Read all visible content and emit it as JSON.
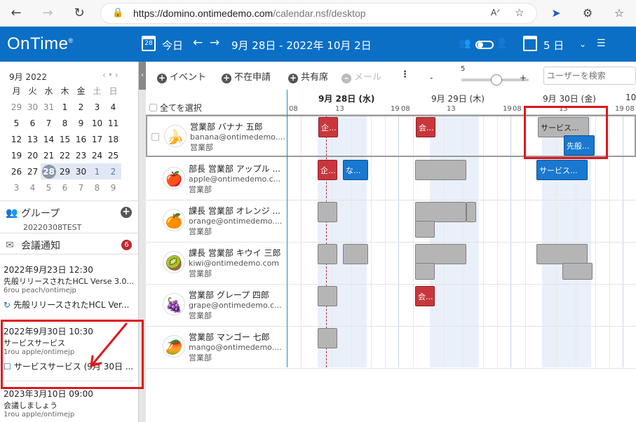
{
  "browser": {
    "url_host": "https://domino.ontimedemo.com",
    "url_path": "/calendar.nsf/desktop"
  },
  "header": {
    "logo": "OnTime",
    "cal_day": "28",
    "today": "今日",
    "date_range": "9月 28日 - 2022年 10月 2日",
    "view_days": "5 日"
  },
  "mini_calendar": {
    "title": "9月 2022",
    "weekdays": [
      "月",
      "火",
      "水",
      "木",
      "金",
      "土",
      "日"
    ],
    "weeks": [
      [
        "29",
        "30",
        "31",
        "1",
        "2",
        "3",
        "4"
      ],
      [
        "5",
        "6",
        "7",
        "8",
        "9",
        "10",
        "11"
      ],
      [
        "12",
        "13",
        "14",
        "15",
        "16",
        "17",
        "18"
      ],
      [
        "19",
        "20",
        "21",
        "22",
        "23",
        "24",
        "25"
      ],
      [
        "26",
        "27",
        "28",
        "29",
        "30",
        "1",
        "2"
      ],
      [
        "3",
        "4",
        "5",
        "6",
        "7",
        "8",
        "9"
      ]
    ]
  },
  "groups": {
    "title": "グループ",
    "name": "20220308TEST"
  },
  "notifications": {
    "title": "会議通知",
    "count": "6",
    "items": [
      {
        "date": "2022年9月23日  12:30",
        "subject": "先般リリースされたHCL Verse 3.0...",
        "who": "6rou peach/ontimejp",
        "link": "先般リリースされたHCL Ver..."
      },
      {
        "date": "2022年9月30日  10:30",
        "subject": "サービスサービス",
        "who": "1rou apple/ontimejp",
        "link": "サービスサービス (9月 30日 ..."
      },
      {
        "date": "2023年3月10日  09:00",
        "subject": "会議しましょう",
        "who": "1rou apple/ontimejp",
        "link": ""
      }
    ]
  },
  "toolbar": {
    "event": "イベント",
    "absence": "不在申請",
    "shared_seat": "共有席",
    "mail": "メール",
    "zoom_value": "5",
    "minus": "-",
    "plus": "+",
    "search_placeholder": "ユーザーを検索"
  },
  "timeline": {
    "select_all": "全てを選択",
    "days": [
      {
        "label": "9月 28日 (水)"
      },
      {
        "label": "9月 29日 (木)"
      },
      {
        "label": "9月 30日 (金)"
      },
      {
        "label": "10"
      }
    ],
    "hours": [
      "08",
      "13",
      "19",
      "08",
      "13",
      "19",
      "08",
      "13",
      "19",
      "08"
    ]
  },
  "people": [
    {
      "name": "営業部 バナナ 五郎",
      "email": "banana@ontimedemo....",
      "dept": "営業部",
      "avatar": "banana-icon"
    },
    {
      "name": "部長 営業部 アップル ...",
      "email": "apple@ontimedemo.c...",
      "dept": "営業部",
      "avatar": "apple-icon"
    },
    {
      "name": "課長 営業部 オレンジ ...",
      "email": "orange@ontimedemo....",
      "dept": "営業部",
      "avatar": "orange-icon"
    },
    {
      "name": "課長 営業部 キウイ 三郎",
      "email": "kiwi@ontimedemo.com",
      "dept": "営業部",
      "avatar": "kiwi-icon"
    },
    {
      "name": "営業部 グレープ 四郎",
      "email": "grape@ontimedemo.c...",
      "dept": "営業部",
      "avatar": "grape-icon"
    },
    {
      "name": "営業部 マンゴー 七郎",
      "email": "mango@ontimedemo....",
      "dept": "営業部",
      "avatar": "mango-icon"
    }
  ],
  "events": {
    "banana": {
      "e1": "企...",
      "e2": "会...",
      "e3": "サービス...",
      "e4": "先般..."
    },
    "apple": {
      "e1": "企...",
      "e2": "な...",
      "e3": "サービス..."
    },
    "grape": {
      "e1": "会..."
    }
  },
  "colors": {
    "brand": "#0b6fc6",
    "event_red": "#c9373d",
    "event_blue": "#1978d0",
    "event_gray": "#b5b5b5",
    "highlight": "#e0161d"
  }
}
